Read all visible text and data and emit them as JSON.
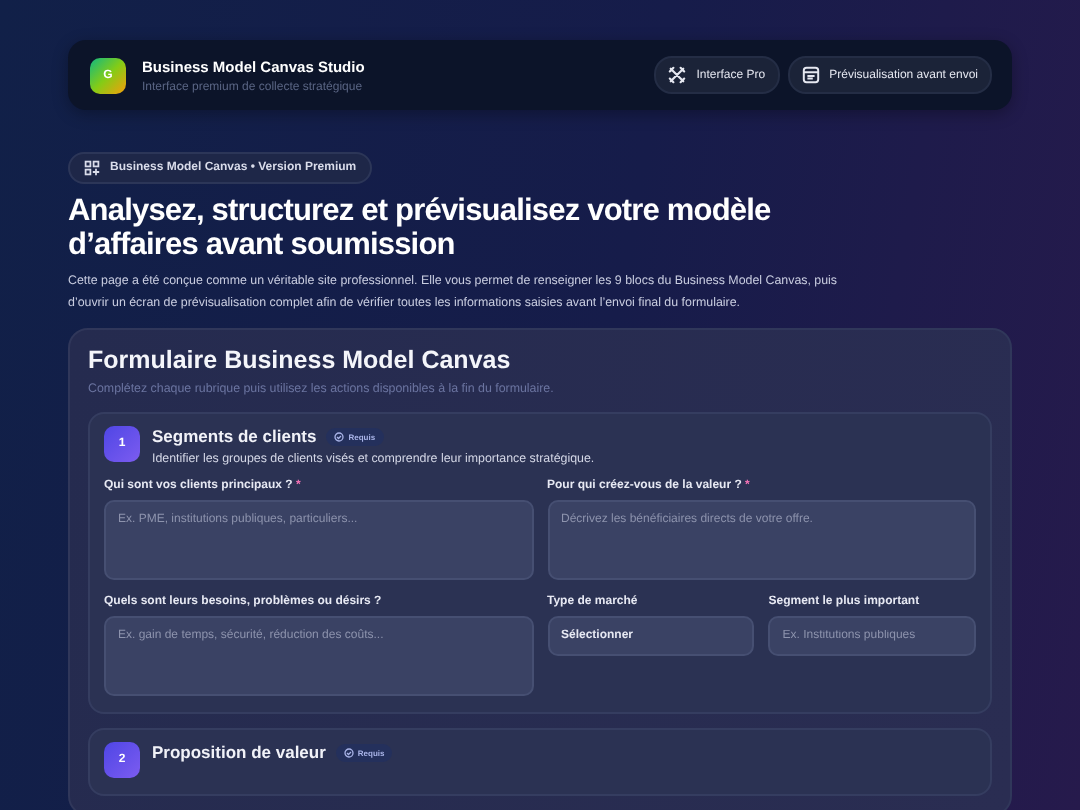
{
  "header": {
    "logo_letter": "G",
    "title": "Business Model Canvas Studio",
    "subtitle": "Interface premium de collecte stratégique",
    "pills": [
      {
        "kind": "tools",
        "label": "Interface Pro"
      },
      {
        "kind": "preview",
        "label": "Prévisualisation avant envoi"
      }
    ]
  },
  "hero": {
    "badge": "Business Model Canvas • Version Premium",
    "title": "Analysez, structurez et prévisualisez votre modèle d’affaires avant soumission",
    "description": "Cette page a été conçue comme un véritable site professionnel. Elle vous permet de renseigner les 9 blocs du Business Model Canvas, puis d’ouvrir un écran de prévisualisation complet afin de vérifier toutes les informations saisies avant l’envoi final du formulaire."
  },
  "form": {
    "title": "Formulaire Business Model Canvas",
    "subtitle": "Complétez chaque rubrique puis utilisez les actions disponibles à la fin du formulaire.",
    "sections": [
      {
        "number": "1",
        "title": "Segments de clients",
        "badge": "Requis",
        "description": "Identifier les groupes de clients visés et comprendre leur importance stratégique.",
        "fields": [
          {
            "kind": "textarea",
            "label": "Qui sont vos clients principaux ?",
            "required_mark": "*",
            "placeholder": "Ex. PME, institutions publiques, particuliers..."
          },
          {
            "kind": "textarea",
            "label": "Pour qui créez-vous de la valeur ?",
            "required_mark": "*",
            "placeholder": "Décrivez les bénéficiaires directs de votre offre."
          },
          {
            "kind": "textarea",
            "label": "Quels sont leurs besoins, problèmes ou désirs ?",
            "placeholder": "Ex. gain de temps, sécurité, réduction des coûts..."
          },
          {
            "kind": "select",
            "label": "Type de marché",
            "value": "Sélectionner"
          },
          {
            "kind": "input",
            "label": "Segment le plus important",
            "placeholder": "Ex. Institutions publiques"
          }
        ]
      },
      {
        "number": "2",
        "title": "Proposition de valeur",
        "badge": "Requis"
      }
    ]
  }
}
